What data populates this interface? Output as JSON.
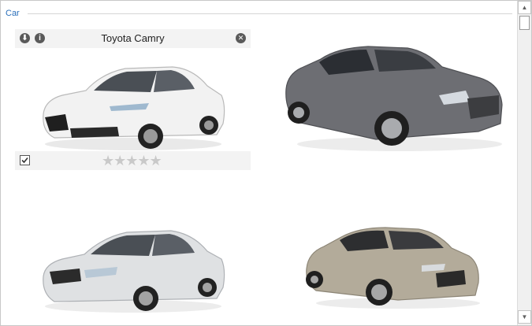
{
  "group": {
    "title": "Car"
  },
  "cards": [
    {
      "title": "Toyota Camry",
      "icons": [
        "download-icon",
        "info-icon",
        "close-icon"
      ],
      "checked": true,
      "rating_stars": "★★★★★",
      "rating_value": 0,
      "body_color": "#f2f2f2"
    },
    {
      "title": "",
      "body_color": "#6d6e73"
    },
    {
      "title": "",
      "body_color": "#dfe1e3"
    },
    {
      "title": "",
      "body_color": "#b3ab9a"
    }
  ],
  "icons": {
    "download": "⬇",
    "info": "i",
    "close": "✕",
    "scroll_up": "▲",
    "scroll_down": "▼"
  },
  "colors": {
    "group_title": "#2a6fba",
    "star_empty": "#c9c9c9"
  }
}
